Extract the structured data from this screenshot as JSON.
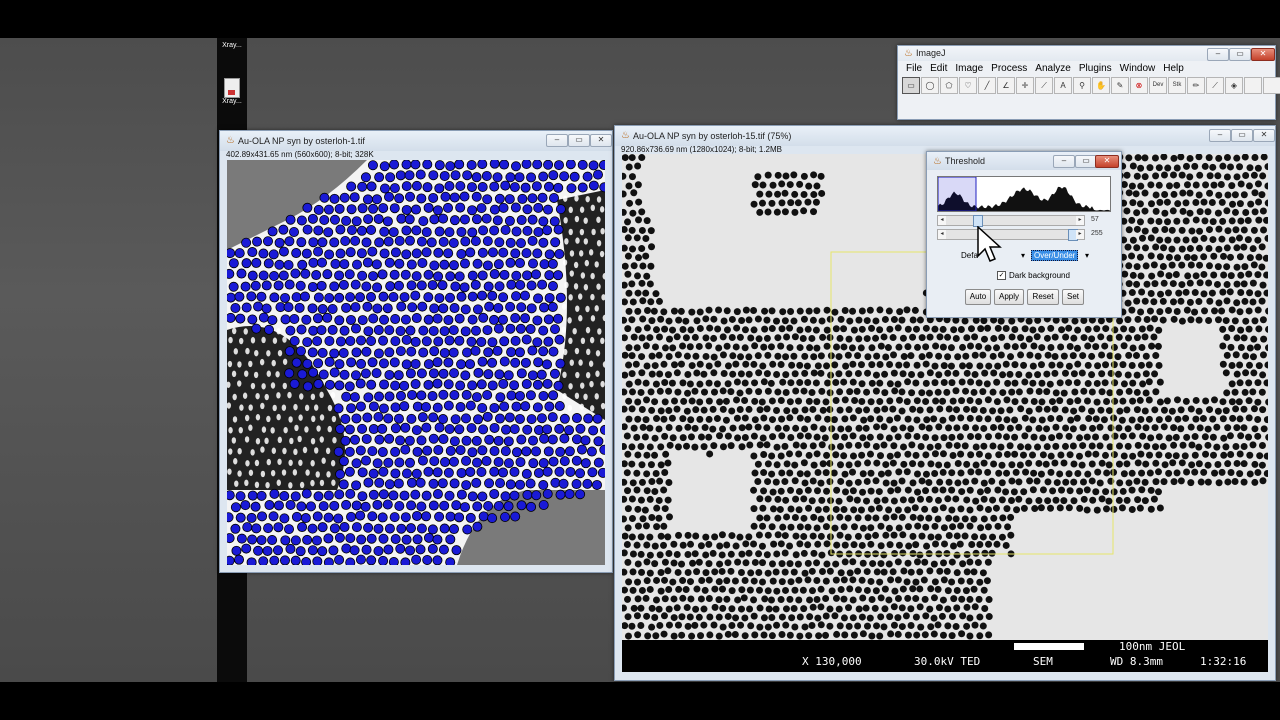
{
  "desktop": {
    "icons": [
      {
        "label": "Xray..."
      },
      {
        "label": "Xray..."
      }
    ]
  },
  "imagej": {
    "title": "ImageJ",
    "menu": [
      "File",
      "Edit",
      "Image",
      "Process",
      "Analyze",
      "Plugins",
      "Window",
      "Help"
    ],
    "tools": [
      {
        "name": "rectangle-tool-icon",
        "glyph": "▭"
      },
      {
        "name": "oval-tool-icon",
        "glyph": "◯"
      },
      {
        "name": "polygon-tool-icon",
        "glyph": "⬠"
      },
      {
        "name": "freehand-tool-icon",
        "glyph": "♡"
      },
      {
        "name": "line-tool-icon",
        "glyph": "╱"
      },
      {
        "name": "angle-tool-icon",
        "glyph": "∠"
      },
      {
        "name": "point-tool-icon",
        "glyph": "✛"
      },
      {
        "name": "wand-tool-icon",
        "glyph": "⟋"
      },
      {
        "name": "text-tool-icon",
        "glyph": "A"
      },
      {
        "name": "magnifier-tool-icon",
        "glyph": "⚲"
      },
      {
        "name": "hand-tool-icon",
        "glyph": "✋"
      },
      {
        "name": "dropper-tool-icon",
        "glyph": "✎"
      },
      {
        "name": "stop-tool-icon",
        "glyph": "⊗"
      },
      {
        "name": "dev-tool-icon",
        "glyph": "Dev"
      },
      {
        "name": "stk-tool-icon",
        "glyph": "Stk"
      },
      {
        "name": "pencil-tool-icon",
        "glyph": "✏"
      },
      {
        "name": "brush-tool-icon",
        "glyph": "⟋"
      },
      {
        "name": "flood-fill-tool-icon",
        "glyph": "◈"
      },
      {
        "name": "empty-tool-1",
        "glyph": ""
      },
      {
        "name": "empty-tool-2",
        "glyph": ""
      },
      {
        "name": "more-tools-icon",
        "glyph": "»"
      }
    ]
  },
  "window1": {
    "title": "Au-OLA NP syn by osterloh-1.tif",
    "info": "402.89x431.65 nm (560x600); 8-bit; 328K"
  },
  "window2": {
    "title": "Au-OLA NP syn by osterloh-15.tif (75%)",
    "info": "920.86x736.69 nm (1280x1024); 8-bit; 1.2MB",
    "scalebar": {
      "label": "100nm JEOL",
      "magnification": "X 130,000",
      "voltage": "30.0kV TED",
      "mode": "SEM",
      "wd": "WD 8.3mm",
      "time": "1:32:16"
    }
  },
  "threshold": {
    "title": "Threshold",
    "min_value": "57",
    "max_value": "255",
    "min_fraction": 0.22,
    "max_fraction": 1.0,
    "method": "Defa",
    "mode": "Over/Under",
    "dark_background_label": "Dark background",
    "dark_background_checked": true,
    "buttons": {
      "auto": "Auto",
      "apply": "Apply",
      "reset": "Reset",
      "set": "Set"
    }
  },
  "colors": {
    "overlay_blue": "#1a1ad6",
    "selection_yellow": "#e6e66a",
    "mode_highlight": "#3a8ee6"
  }
}
